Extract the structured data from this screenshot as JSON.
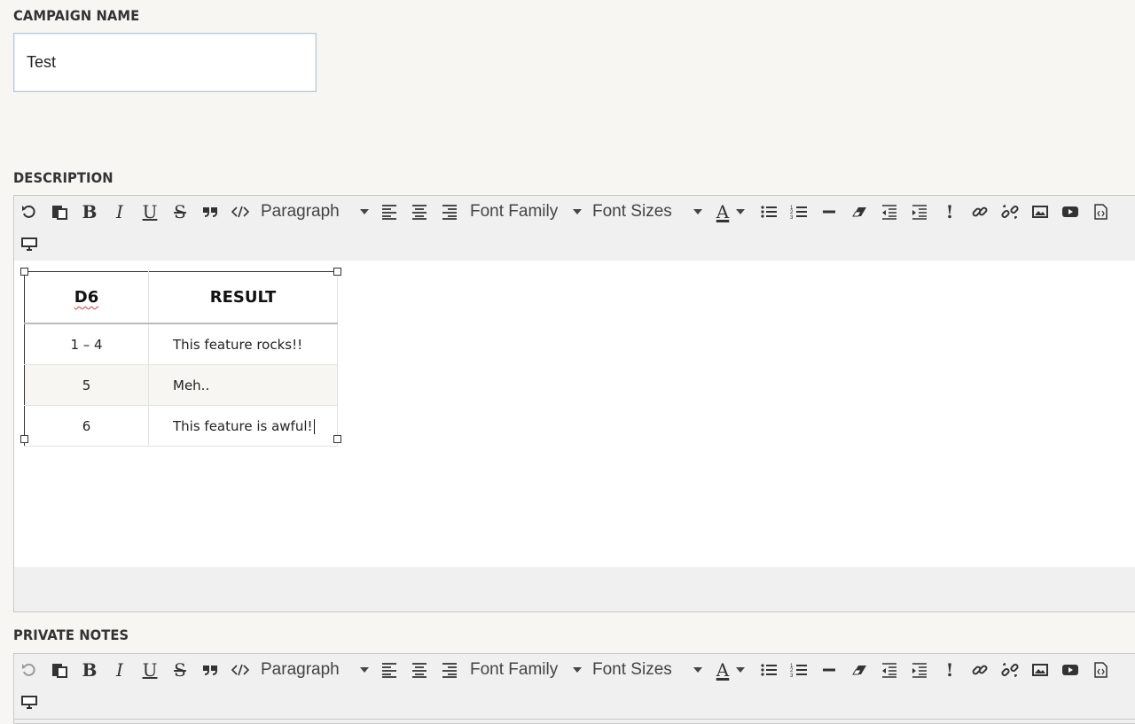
{
  "campaign": {
    "label": "CAMPAIGN NAME",
    "value": "Test"
  },
  "description": {
    "label": "DESCRIPTION",
    "toolbar": {
      "format_select": "Paragraph",
      "font_family_select": "Font Family",
      "font_size_select": "Font Sizes",
      "exclamation": "!"
    },
    "table": {
      "headers": [
        "D6",
        "RESULT"
      ],
      "rows": [
        [
          "1 – 4",
          "This feature rocks!!"
        ],
        [
          "5",
          "Meh.."
        ],
        [
          "6",
          "This feature is awful!"
        ]
      ]
    }
  },
  "private_notes": {
    "label": "PRIVATE NOTES",
    "toolbar": {
      "format_select": "Paragraph",
      "font_family_select": "Font Family",
      "font_size_select": "Font Sizes",
      "exclamation": "!"
    }
  },
  "icons": [
    "undo-icon",
    "paste-icon",
    "bold-icon",
    "italic-icon",
    "underline-icon",
    "strikethrough-icon",
    "blockquote-icon",
    "code-icon",
    "align-left-icon",
    "align-center-icon",
    "align-right-icon",
    "text-color-icon",
    "bullet-list-icon",
    "numbered-list-icon",
    "horizontal-rule-icon",
    "eraser-icon",
    "outdent-icon",
    "indent-icon",
    "exclamation-icon",
    "link-icon",
    "unlink-icon",
    "image-icon",
    "video-icon",
    "source-code-icon",
    "preview-icon"
  ]
}
